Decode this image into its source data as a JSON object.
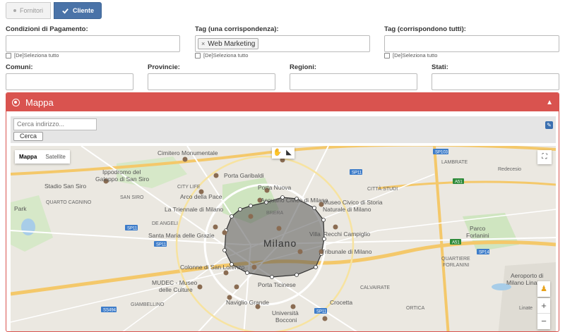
{
  "toggle": {
    "fornitori_label": "Fornitori",
    "cliente_label": "Cliente"
  },
  "fields": {
    "condizioni": {
      "label": "Condizioni di Pagamento:",
      "select_all": "[De]Seleziona tutto"
    },
    "tag_una": {
      "label": "Tag (una corrispondenza):",
      "chip": "Web Marketing",
      "chip_remove": "×",
      "select_all": "[De]Seleziona tutto"
    },
    "tag_tutti": {
      "label": "Tag (corrispondono tutti):",
      "select_all": "[De]Seleziona tutto"
    },
    "comuni": {
      "label": "Comuni:"
    },
    "province": {
      "label": "Provincie:"
    },
    "regioni": {
      "label": "Regioni:"
    },
    "stati": {
      "label": "Stati:"
    }
  },
  "panel": {
    "title": "Mappa",
    "search_placeholder": "Cerca indirizzo...",
    "search_button": "Cerca",
    "accent_color": "#d9534f"
  },
  "map": {
    "type_buttons": {
      "map": "Mappa",
      "satellite": "Satellite"
    },
    "zoom_in": "+",
    "zoom_out": "−",
    "labels": {
      "cimitero": "Cimitero Monumentale",
      "ippodromo": "Ippodromo del",
      "galoppo": "Galoppo di San Siro",
      "stadio": "Stadio San Siro",
      "citylife": "CITY LIFE",
      "arco": "Arco della Pace",
      "triennale": "La Triennale di Milano",
      "portagaribaldi": "Porta Garibaldi",
      "portanuova": "Porta Nuova",
      "acquario": "Acquario Civico di Milano",
      "brera": "BRERA",
      "museo1": "Museo Civico di Storia",
      "museo2": "Naturale di Milano",
      "cittastudi": "CITTÀ STUDI",
      "lambrate": "LAMBRATE",
      "redecesio": "Redecesio",
      "sansiro": "SAN SIRO",
      "quartocagnino": "QUARTO CAGNINO",
      "park": "Park",
      "deangeli": "DE ANGELI",
      "santamaria": "Santa Maria delle Grazie",
      "milano": "Milano",
      "villa": "Villa",
      "recchi": "Recchi Campiglio",
      "tribunale": "Tribunale di Milano",
      "colonne": "Colonne di San Lorenzo",
      "portaticinese": "Porta Ticinese",
      "calvairate": "CALVAIRATE",
      "parcoforlanini1": "Parco",
      "parcoforlanini2": "Forlanini",
      "quartiere1": "QUARTIERE",
      "quartiere2": "FORLANINI",
      "aeroporto1": "Aeroporto di",
      "aeroporto2": "Milano Linate",
      "linate": "Linate",
      "mudec1": "MUDEC - Museo",
      "mudec2": "delle Culture",
      "giambellino": "GIAMBELLINO",
      "naviglio": "Naviglio Grande",
      "crocetta": "Crocetta",
      "universita1": "Università",
      "universita2": "Bocconi",
      "ortica": "ORTICA"
    },
    "roads": [
      "SP103",
      "SP11",
      "SP11",
      "SP11",
      "SP11",
      "SP14",
      "A51",
      "A51",
      "SS494"
    ]
  }
}
